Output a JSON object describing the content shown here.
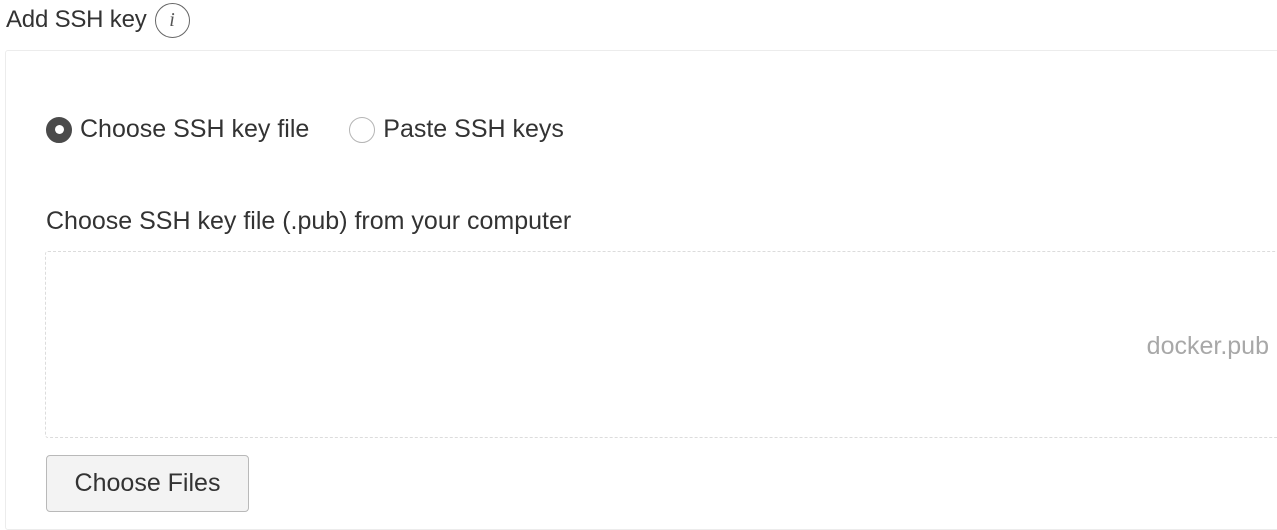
{
  "header": {
    "title": "Add SSH key",
    "info_icon": "i"
  },
  "radio_group": {
    "options": [
      {
        "label": "Choose SSH key file",
        "checked": true
      },
      {
        "label": "Paste SSH keys",
        "checked": false
      }
    ]
  },
  "file_section": {
    "label": "Choose SSH key file (.pub) from your computer",
    "selected_file": "docker.pub",
    "button_label": "Choose Files"
  },
  "colors": {
    "radio_checked": "#4a4a4a",
    "text": "#333333",
    "placeholder_text": "#a8a8a8"
  }
}
